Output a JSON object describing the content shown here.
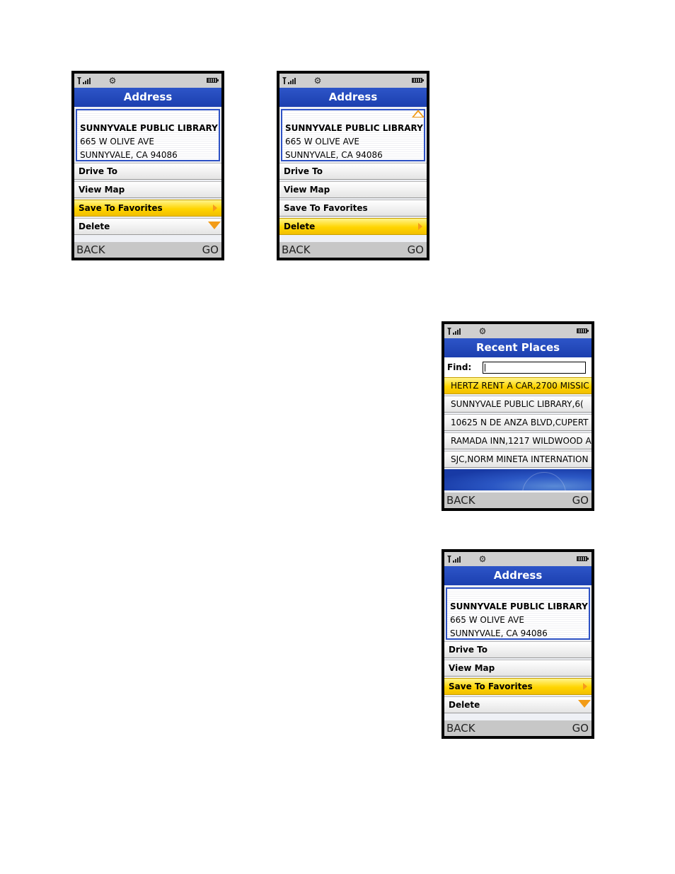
{
  "status_icons": [
    "signal-icon",
    "settings-icon",
    "battery-icon"
  ],
  "colors": {
    "title_bar": "#1c3faf",
    "highlight": "#ffd500",
    "arrow": "#f29b16"
  },
  "screens": [
    {
      "title": "Address",
      "address": {
        "name": "SUNNYVALE PUBLIC LIBRARY",
        "street": "665 W OLIVE AVE",
        "city": "SUNNYVALE, CA 94086"
      },
      "menu": [
        "Drive To",
        "View Map",
        "Save To Favorites",
        "Delete"
      ],
      "selected": "Save To Favorites",
      "scroll_indicator": "down",
      "softkeys": {
        "left": "BACK",
        "right": "GO"
      }
    },
    {
      "title": "Address",
      "address": {
        "name": "SUNNYVALE PUBLIC LIBRARY",
        "street": "665 W OLIVE AVE",
        "city": "SUNNYVALE, CA 94086"
      },
      "menu": [
        "Drive To",
        "View Map",
        "Save To Favorites",
        "Delete"
      ],
      "selected": "Delete",
      "scroll_indicator": "up",
      "softkeys": {
        "left": "BACK",
        "right": "GO"
      }
    },
    {
      "title": "Recent Places",
      "find_label": "Find:",
      "find_value": "",
      "places": [
        "HERTZ RENT A CAR,2700 MISSIC",
        "SUNNYVALE PUBLIC LIBRARY,6(",
        "10625 N DE ANZA BLVD,CUPERT",
        "RAMADA INN,1217 WILDWOOD A",
        "SJC,NORM MINETA INTERNATION"
      ],
      "selected": "HERTZ RENT A CAR,2700 MISSIC",
      "softkeys": {
        "left": "BACK",
        "right": "GO"
      }
    },
    {
      "title": "Address",
      "address": {
        "name": "SUNNYVALE PUBLIC LIBRARY",
        "street": "665 W OLIVE AVE",
        "city": "SUNNYVALE, CA 94086"
      },
      "menu": [
        "Drive To",
        "View Map",
        "Save To Favorites",
        "Delete"
      ],
      "selected": "Save To Favorites",
      "scroll_indicator": "down",
      "softkeys": {
        "left": "BACK",
        "right": "GO"
      }
    }
  ]
}
